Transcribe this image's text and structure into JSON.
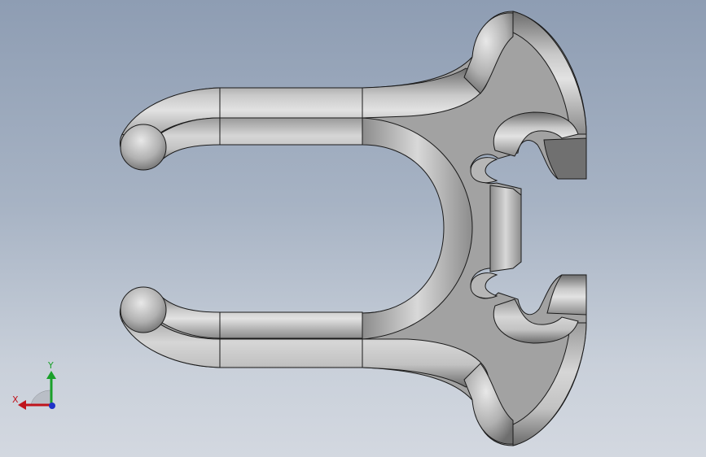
{
  "viewport": {
    "background_top": "#8e9db3",
    "background_bottom": "#d3d8e0"
  },
  "model": {
    "part_color": "#9b9b9b",
    "face_color": "#a3a3a3",
    "highlight_color": "#d9d9d9",
    "edge_color": "#1a1a1a"
  },
  "triad": {
    "x_label": "X",
    "y_label": "Y",
    "x_color": "#c0141c",
    "y_color": "#1aa02a",
    "z_color": "#1f33c8"
  }
}
